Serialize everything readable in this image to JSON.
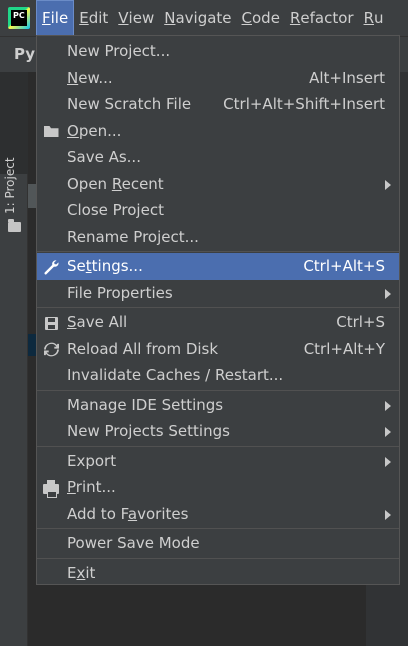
{
  "app": {
    "logo_text": "PC",
    "panel_title": "Py"
  },
  "menubar": [
    {
      "label": "File",
      "mnemonic_index": 0,
      "active": true
    },
    {
      "label": "Edit",
      "mnemonic_index": 0
    },
    {
      "label": "View",
      "mnemonic_index": 0
    },
    {
      "label": "Navigate",
      "mnemonic_index": 0
    },
    {
      "label": "Code",
      "mnemonic_index": 0
    },
    {
      "label": "Refactor",
      "mnemonic_index": 0
    },
    {
      "label": "Ru",
      "mnemonic_index": 0
    }
  ],
  "sidebar": {
    "project_tab": "1: Project"
  },
  "file_menu": {
    "groups": [
      [
        {
          "label": "New Project...",
          "icon": "",
          "shortcut": "",
          "submenu": false
        },
        {
          "label": "New...",
          "mn": "N",
          "rest": "ew...",
          "icon": "",
          "shortcut": "Alt+Insert",
          "submenu": false
        },
        {
          "label": "New Scratch File",
          "icon": "",
          "shortcut": "Ctrl+Alt+Shift+Insert",
          "submenu": false
        },
        {
          "label": "Open...",
          "mn": "O",
          "rest": "pen...",
          "icon": "folder-open-icon",
          "shortcut": "",
          "submenu": false
        },
        {
          "label": "Save As...",
          "icon": "",
          "shortcut": "",
          "submenu": false
        },
        {
          "label": "Open Recent",
          "pre": "Open ",
          "mn": "R",
          "rest": "ecent",
          "icon": "",
          "shortcut": "",
          "submenu": true
        },
        {
          "label": "Close Project",
          "icon": "",
          "shortcut": "",
          "submenu": false
        },
        {
          "label": "Rename Project...",
          "icon": "",
          "shortcut": "",
          "submenu": false
        }
      ],
      [
        {
          "label": "Settings...",
          "pre": "Se",
          "mn": "t",
          "rest": "tings...",
          "icon": "wrench-icon",
          "shortcut": "Ctrl+Alt+S",
          "submenu": false,
          "selected": true
        },
        {
          "label": "File Properties",
          "icon": "",
          "shortcut": "",
          "submenu": true
        }
      ],
      [
        {
          "label": "Save All",
          "mn": "S",
          "rest": "ave All",
          "icon": "save-disk-icon",
          "shortcut": "Ctrl+S",
          "submenu": false
        },
        {
          "label": "Reload All from Disk",
          "icon": "reload-icon",
          "shortcut": "Ctrl+Alt+Y",
          "submenu": false
        },
        {
          "label": "Invalidate Caches / Restart...",
          "icon": "",
          "shortcut": "",
          "submenu": false
        }
      ],
      [
        {
          "label": "Manage IDE Settings",
          "icon": "",
          "shortcut": "",
          "submenu": true
        },
        {
          "label": "New Projects Settings",
          "icon": "",
          "shortcut": "",
          "submenu": true
        }
      ],
      [
        {
          "label": "Export",
          "icon": "",
          "shortcut": "",
          "submenu": true
        },
        {
          "label": "Print...",
          "mn": "P",
          "rest": "rint...",
          "icon": "printer-icon",
          "shortcut": "",
          "submenu": false
        },
        {
          "label": "Add to Favorites",
          "pre": "Add to F",
          "mn": "a",
          "rest": "vorites",
          "icon": "",
          "shortcut": "",
          "submenu": true
        }
      ],
      [
        {
          "label": "Power Save Mode",
          "icon": "",
          "shortcut": "",
          "submenu": false
        }
      ],
      [
        {
          "label": "Exit",
          "pre": "E",
          "mn": "x",
          "rest": "it",
          "icon": "",
          "shortcut": "",
          "submenu": false
        }
      ]
    ]
  }
}
